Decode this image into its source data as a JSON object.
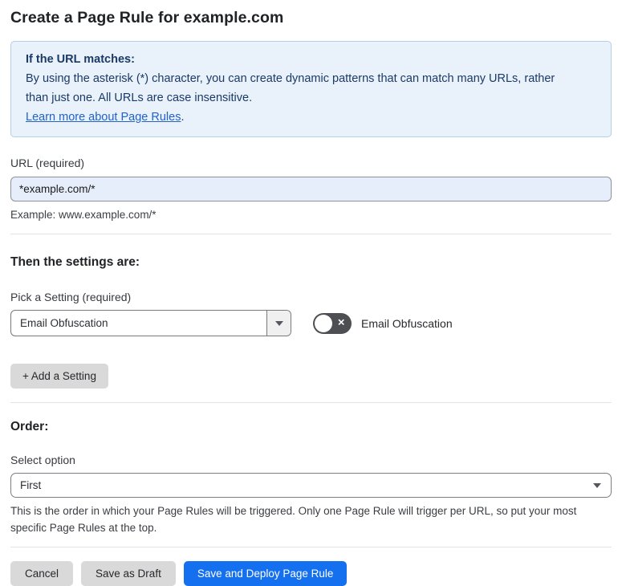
{
  "header": {
    "title": "Create a Page Rule for example.com"
  },
  "info_box": {
    "heading": "If the URL matches:",
    "body": "By using the asterisk (*) character, you can create dynamic patterns that can match many URLs, rather than just one. All URLs are case insensitive.",
    "link_label": "Learn more about Page Rules",
    "link_suffix": "."
  },
  "url_section": {
    "label": "URL (required)",
    "input_value": "*example.com/*",
    "example": "Example: www.example.com/*"
  },
  "settings_section": {
    "heading": "Then the settings are:",
    "picker_label": "Pick a Setting (required)",
    "selected_setting": "Email Obfuscation",
    "toggle": {
      "state": "off",
      "x_glyph": "✕",
      "label": "Email Obfuscation"
    },
    "add_button_label": "+ Add a Setting"
  },
  "order_section": {
    "heading": "Order:",
    "select_label": "Select option",
    "selected_option": "First",
    "help_text": "This is the order in which your Page Rules will be triggered. Only one Page Rule will trigger per URL, so put your most specific Page Rules at the top."
  },
  "footer": {
    "cancel_label": "Cancel",
    "save_draft_label": "Save as Draft",
    "save_deploy_label": "Save and Deploy Page Rule"
  },
  "colors": {
    "accent_blue": "#1570ef",
    "info_bg": "#e9f1fb",
    "info_border": "#b3cfe9",
    "info_text": "#1b3a66",
    "link_blue": "#2262c9",
    "input_bg": "#e7eefb",
    "toggle_off_bg": "#4d4f52"
  }
}
